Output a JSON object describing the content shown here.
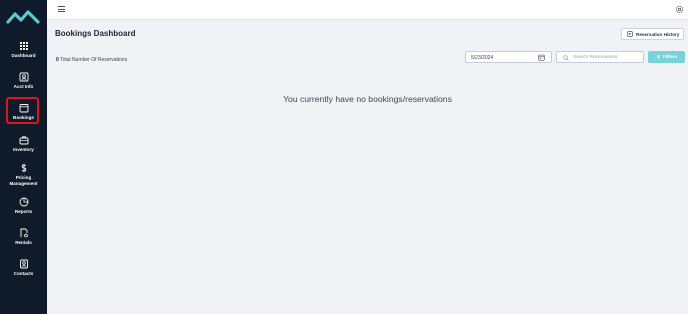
{
  "sidebar": {
    "items": [
      {
        "label": "Dashboard",
        "icon": "grid-icon"
      },
      {
        "label": "Acct Info",
        "icon": "account-card-icon"
      },
      {
        "label": "Bookings",
        "icon": "calendar-icon"
      },
      {
        "label": "Inventory",
        "icon": "briefcase-icon"
      },
      {
        "label": "Pricing Management",
        "icon": "dollar-icon"
      },
      {
        "label": "Reports",
        "icon": "pie-chart-icon"
      },
      {
        "label": "Rentals",
        "icon": "rental-icon"
      },
      {
        "label": "Contacts",
        "icon": "contacts-icon"
      }
    ],
    "active_item": "Bookings",
    "highlight_color": "#e0151b",
    "background_color": "#0f1a2a"
  },
  "header": {
    "menu_icon": "hamburger-icon",
    "settings_icon": "gear-icon"
  },
  "main": {
    "title": "Bookings Dashboard",
    "history_button_label": "Reservation History",
    "reservation_count": "0",
    "reservation_count_label": "Total Number Of Reservations",
    "date_value": "5/23/2024",
    "search_placeholder": "Search Reservations",
    "filters_label": "Filters",
    "filters_color": "#77d3d8",
    "empty_message": "You currently have no bookings/reservations"
  }
}
